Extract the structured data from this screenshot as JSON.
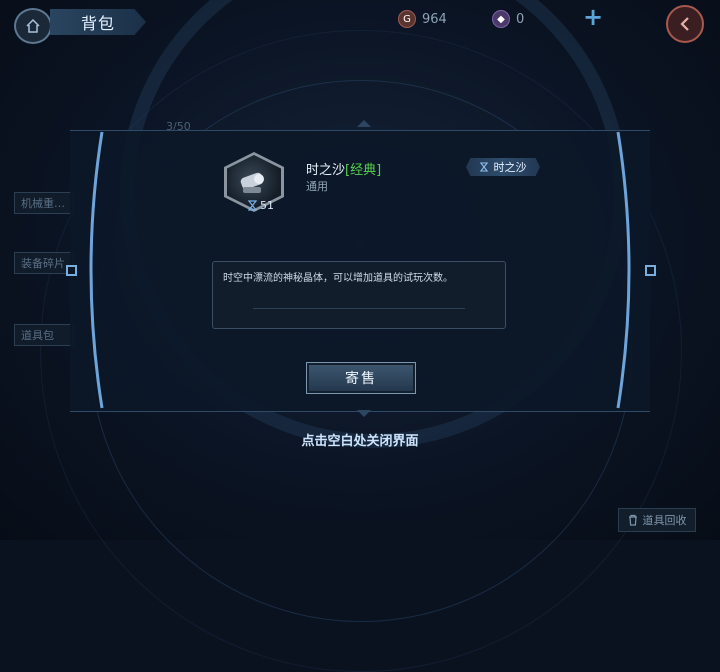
{
  "header": {
    "title": "背包",
    "gold_amount": "964",
    "gold_symbol": "G",
    "gem_amount": "0",
    "home_icon": "home-icon",
    "back_icon": "back-arrow-icon",
    "add_icon": "plus-icon"
  },
  "background": {
    "capacity": "3/50",
    "side_tabs": [
      "机械重…",
      "装备碎片",
      "道具包"
    ]
  },
  "item": {
    "name": "时之沙",
    "quality": "[经典]",
    "type": "通用",
    "count": "51",
    "tag_label": "时之沙",
    "description": "时空中漂流的神秘晶体，可以增加道具的试玩次数。"
  },
  "actions": {
    "sell_label": "寄售",
    "close_hint": "点击空白处关闭界面",
    "recycle_label": "道具回收"
  },
  "colors": {
    "quality_green": "#58d04c",
    "accent_blue": "#7aaee0",
    "back_red": "#a8584e"
  }
}
